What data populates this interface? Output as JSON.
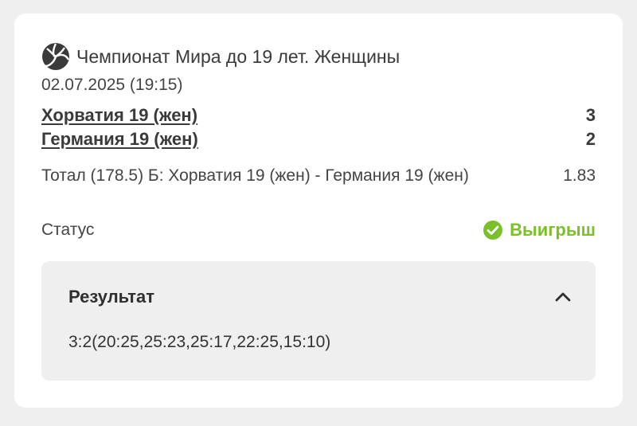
{
  "event": {
    "tournament": "Чемпионат Мира до 19 лет. Женщины",
    "datetime": "02.07.2025 (19:15)",
    "sport_icon": "volleyball-icon"
  },
  "teams": [
    {
      "name": "Хорватия 19 (жен)",
      "score": "3"
    },
    {
      "name": "Германия 19 (жен)",
      "score": "2"
    }
  ],
  "bet": {
    "description": "Тотал (178.5) Б: Хорватия 19 (жен) - Германия 19 (жен)",
    "odds": "1.83"
  },
  "status": {
    "label": "Статус",
    "value": "Выигрыш",
    "color": "#7bbf2a",
    "icon": "check-circle-icon"
  },
  "result": {
    "title": "Результат",
    "score_detail": "3:2(20:25,25:23,25:17,22:25,15:10)",
    "toggle_icon": "chevron-up-icon"
  },
  "colors": {
    "background": "#efefef",
    "card": "#ffffff",
    "panel": "#efefef",
    "text": "#333333",
    "success": "#7bbf2a"
  }
}
